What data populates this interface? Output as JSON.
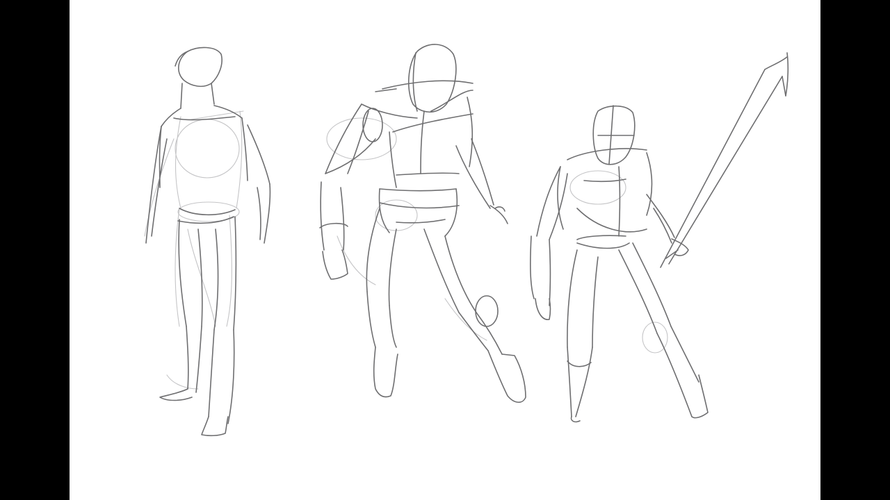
{
  "scene": {
    "background_color": "#000000",
    "canvas_color": "#ffffff",
    "line_color_dark": "#6e6e70",
    "line_color_mid": "#8a8a8c",
    "line_color_light": "#c4c4c6"
  }
}
